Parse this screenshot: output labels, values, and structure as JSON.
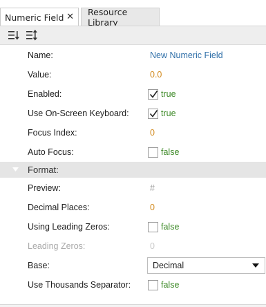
{
  "tabs": [
    {
      "label": "Numeric Field",
      "close": "✕"
    },
    {
      "label": "Resource Library"
    }
  ],
  "toolbar": {
    "sort_icon": "sort-categorized-icon",
    "sort_alpha_icon": "sort-alphabetical-icon"
  },
  "properties": {
    "name": {
      "label": "Name:",
      "value": "New Numeric Field"
    },
    "value": {
      "label": "Value:",
      "value": "0.0"
    },
    "enabled": {
      "label": "Enabled:",
      "checked": true,
      "value": "true"
    },
    "onscreen_keyboard": {
      "label": "Use On-Screen Keyboard:",
      "checked": true,
      "value": "true"
    },
    "focus_index": {
      "label": "Focus Index:",
      "value": "0"
    },
    "auto_focus": {
      "label": "Auto Focus:",
      "checked": false,
      "value": "false"
    }
  },
  "format": {
    "title": "Format:",
    "preview": {
      "label": "Preview:",
      "value": "#"
    },
    "decimal_places": {
      "label": "Decimal Places:",
      "value": "0"
    },
    "leading_zeros_toggle": {
      "label": "Using Leading Zeros:",
      "checked": false,
      "value": "false"
    },
    "leading_zeros": {
      "label": "Leading Zeros:",
      "value": "0"
    },
    "base": {
      "label": "Base:",
      "selected": "Decimal"
    },
    "thousands_separator": {
      "label": "Use Thousands Separator:",
      "checked": false,
      "value": "false"
    }
  },
  "colors": {
    "link": "#2f6fa8",
    "number": "#d28a1e",
    "boolean": "#3e8a28",
    "section_bg": "#e5e5e5"
  }
}
